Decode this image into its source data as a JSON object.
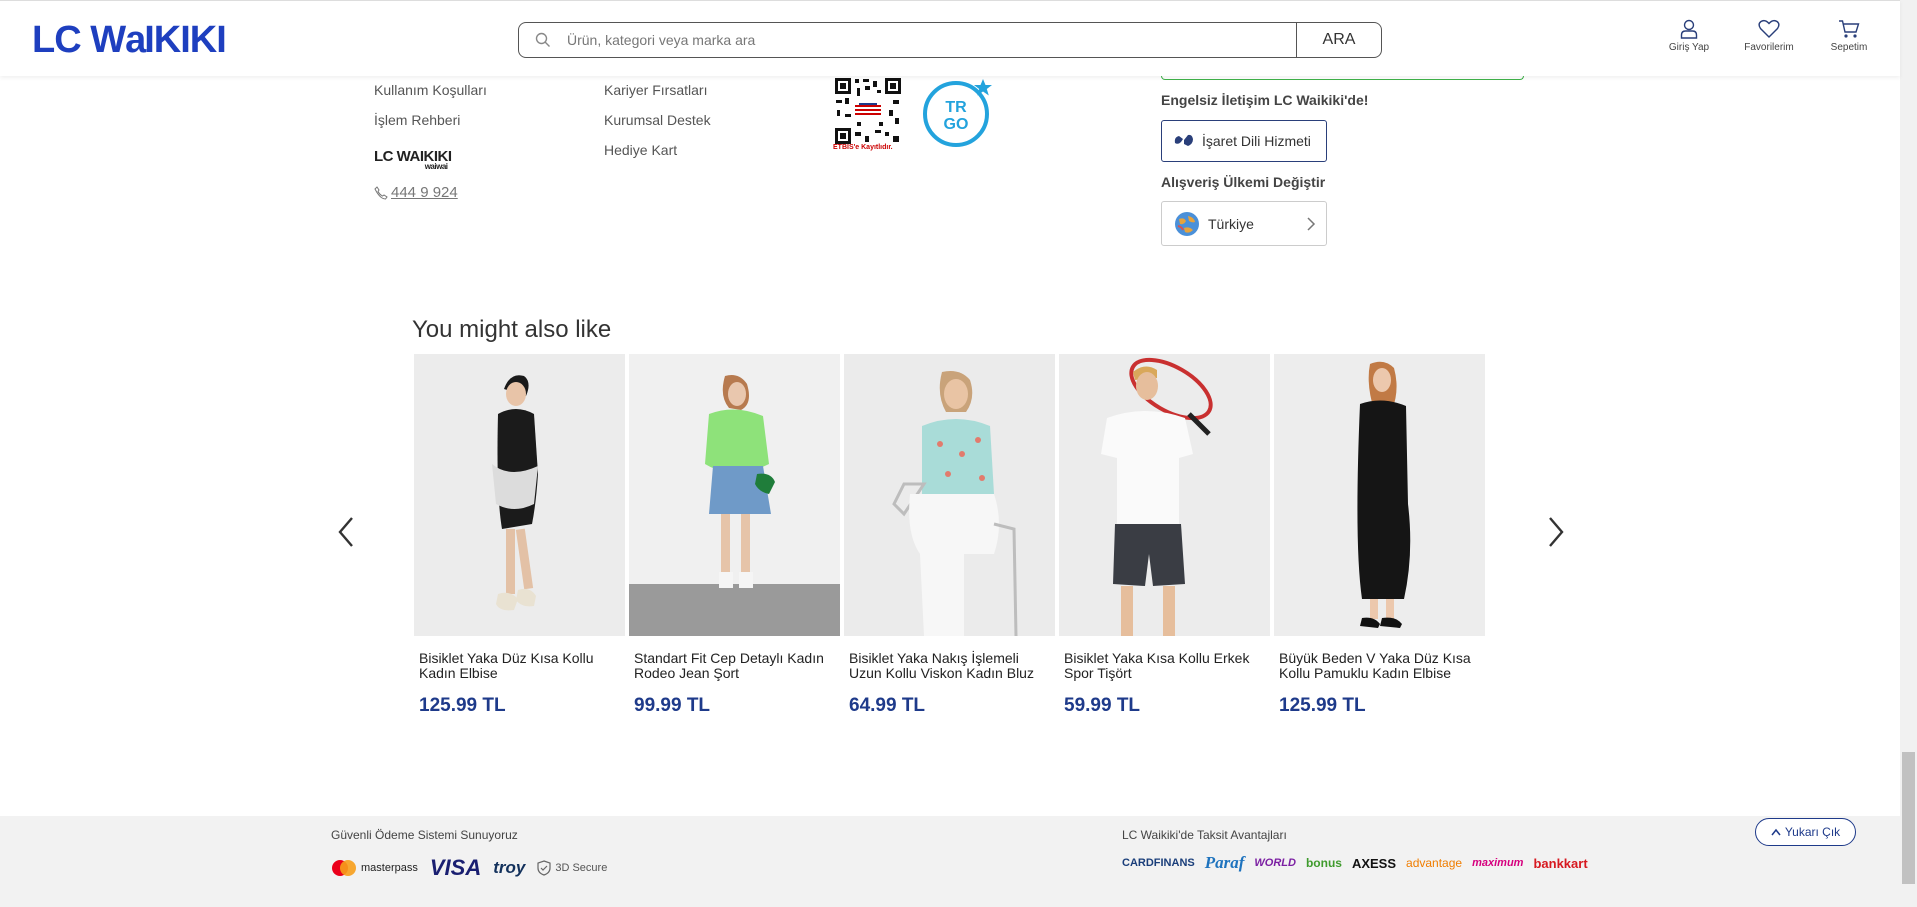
{
  "header": {
    "logo": "LC Waikiki",
    "search_placeholder": "Ürün, kategori veya marka ara",
    "search_button": "ARA",
    "login": "Giriş Yap",
    "favorites": "Favorilerim",
    "cart": "Sepetim"
  },
  "footer_links": {
    "col1": [
      "Kullanım Koşulları",
      "İşlem Rehberi"
    ],
    "col2": [
      "Kariyer Fırsatları",
      "Kurumsal Destek",
      "Hediye Kart"
    ],
    "phone": "444 9 924",
    "small_logo": "LC Waikiki",
    "small_logo_sub": "waiwai",
    "etbis": "ETBIS'e Kayıtlıdır.",
    "trgo": "TR GO"
  },
  "accessibility": {
    "title": "Engelsiz İletişim LC Waikiki'de!",
    "sign_button": "İşaret Dili Hizmeti"
  },
  "country": {
    "title": "Alışveriş Ülkemi Değiştir",
    "selected": "Türkiye"
  },
  "recommendations": {
    "title": "You might also like",
    "products": [
      {
        "name": "Bisiklet Yaka Düz Kısa Kollu Kadın Elbise",
        "price": "125.99 TL"
      },
      {
        "name": "Standart Fit Cep Detaylı Kadın Rodeo Jean Şort",
        "price": "99.99 TL"
      },
      {
        "name": "Bisiklet Yaka Nakış İşlemeli Uzun Kollu Viskon Kadın Bluz",
        "price": "64.99 TL"
      },
      {
        "name": "Bisiklet Yaka Kısa Kollu Erkek Spor Tişört",
        "price": "59.99 TL"
      },
      {
        "name": "Büyük Beden V Yaka Düz Kısa Kollu Pamuklu Kadın Elbise",
        "price": "125.99 TL"
      }
    ]
  },
  "bottom": {
    "payment_title": "Güvenli Ödeme Sistemi Sunuyoruz",
    "payment_logos": [
      "masterpass",
      "VISA",
      "troy",
      "3D Secure"
    ],
    "installment_title": "LC Waikiki'de Taksit Avantajları",
    "bank_logos": [
      "CARDFINANS",
      "Paraf",
      "WORLD",
      "bonus",
      "AXESS",
      "advantage",
      "maximum",
      "bankkart"
    ],
    "back_to_top": "Yukarı Çık"
  }
}
